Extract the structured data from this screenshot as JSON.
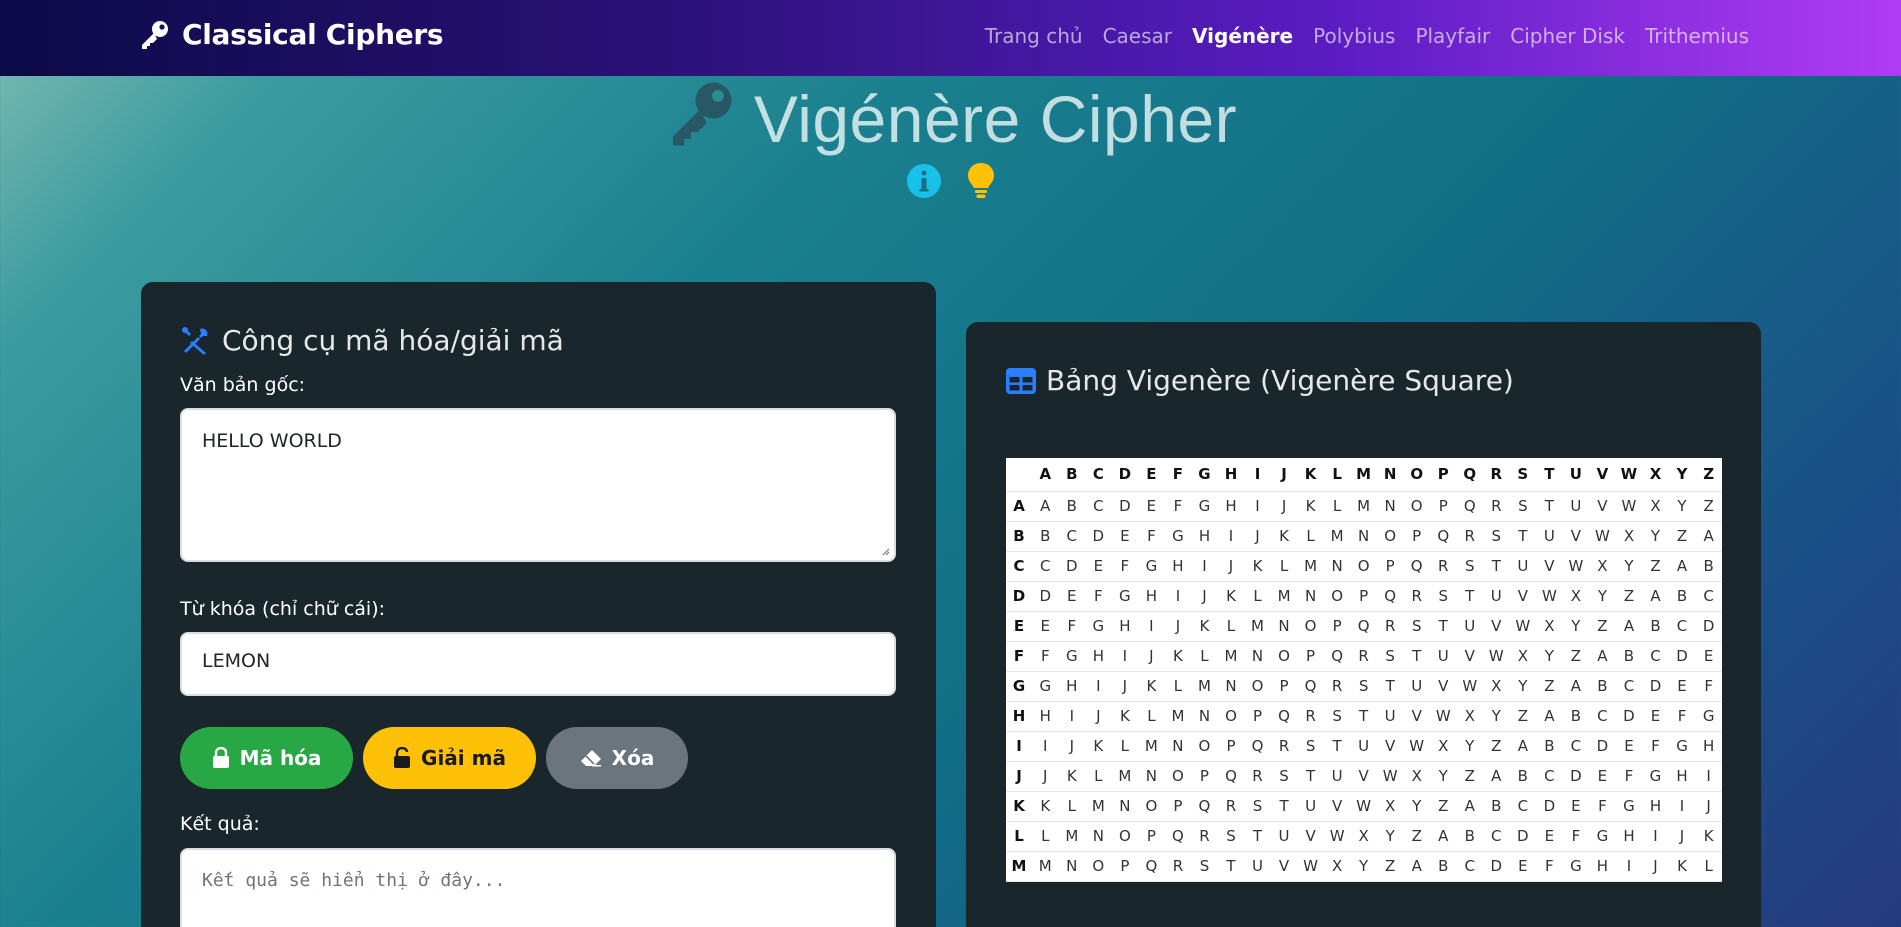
{
  "nav": {
    "brand": "Classical Ciphers",
    "brand_icon": "key-icon",
    "links": [
      {
        "label": "Trang chủ",
        "active": false
      },
      {
        "label": "Caesar",
        "active": false
      },
      {
        "label": "Vigénère",
        "active": true
      },
      {
        "label": "Polybius",
        "active": false
      },
      {
        "label": "Playfair",
        "active": false
      },
      {
        "label": "Cipher Disk",
        "active": false
      },
      {
        "label": "Trithemius",
        "active": false
      }
    ]
  },
  "hero": {
    "title": "Vigénère Cipher",
    "icons": [
      "info-circle-icon",
      "lightbulb-icon"
    ]
  },
  "tool": {
    "title": "Công cụ mã hóa/giải mã",
    "plaintext_label": "Văn bản gốc:",
    "plaintext_value": "HELLO WORLD",
    "keyword_label": "Từ khóa (chỉ chữ cái):",
    "keyword_value": "LEMON",
    "encrypt_label": "Mã hóa",
    "decrypt_label": "Giải mã",
    "clear_label": "Xóa",
    "result_label": "Kết quả:",
    "result_placeholder": "Kết quả sẽ hiển thị ở đây..."
  },
  "square": {
    "title": "Bảng Vigenère (Vigenère Square)",
    "alphabet": "ABCDEFGHIJKLMNOPQRSTUVWXYZ",
    "visible_rows": [
      "A",
      "B",
      "C",
      "D",
      "E",
      "F",
      "G",
      "H",
      "I",
      "J",
      "K",
      "L",
      "M"
    ]
  },
  "colors": {
    "nav_start": "#0c0a47",
    "nav_end": "#b13cf5",
    "card_bg": "#19272c",
    "encrypt": "#28a745",
    "decrypt": "#ffc107",
    "clear": "#6c757d",
    "icon_accent": "#2a7fff",
    "info": "#17c1e8",
    "bulb": "#ffc107"
  }
}
